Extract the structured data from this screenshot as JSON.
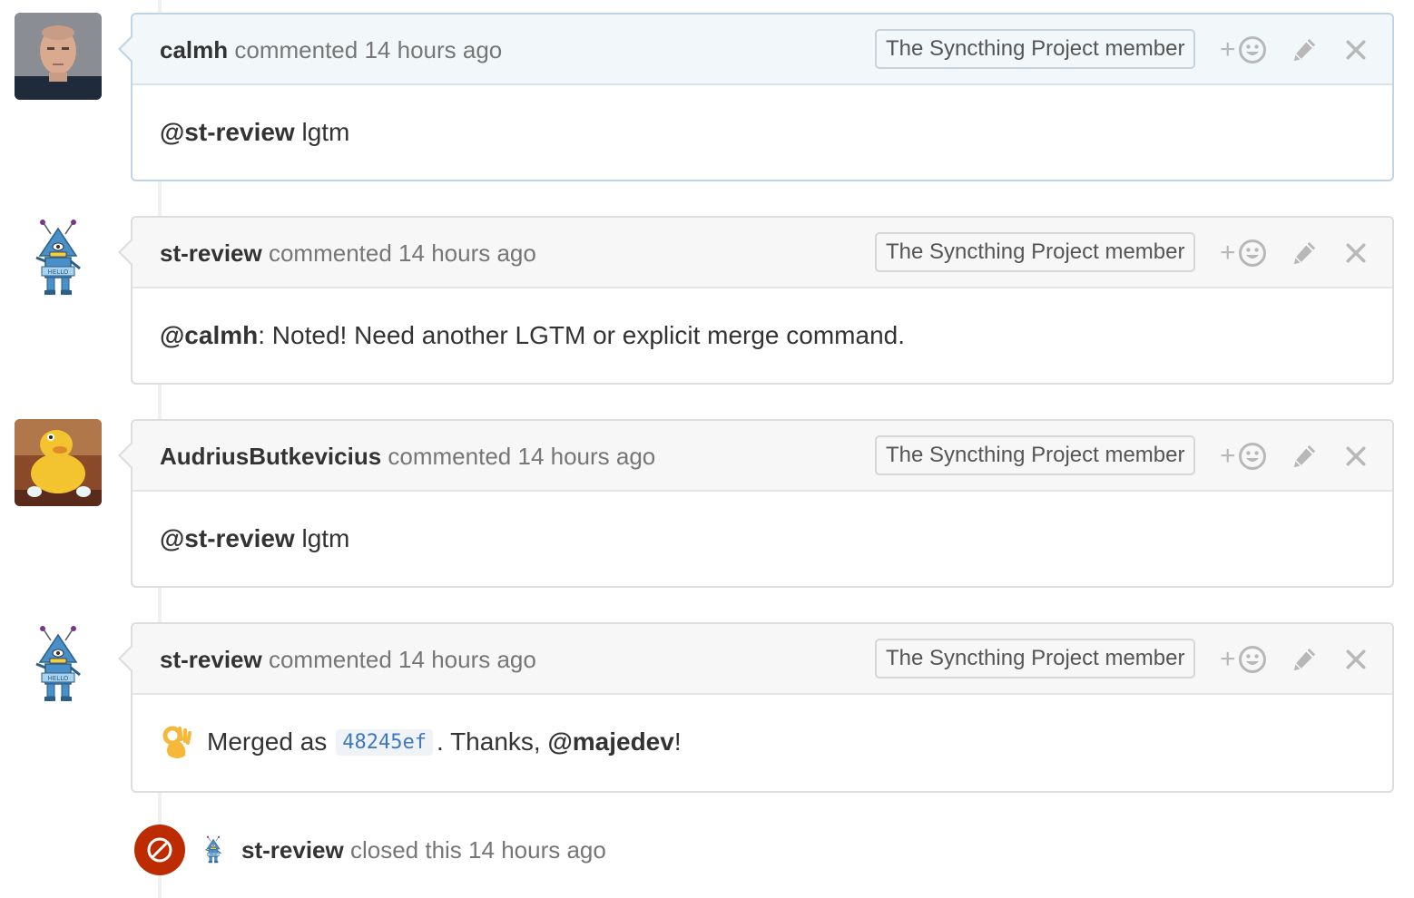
{
  "comments": [
    {
      "author": "calmh",
      "action": "commented",
      "time": "14 hours ago",
      "badge": "The Syncthing Project member",
      "avatar": "calmh-photo-avatar",
      "body": {
        "mention": "@st-review",
        "text": " lgtm"
      }
    },
    {
      "author": "st-review",
      "action": "commented",
      "time": "14 hours ago",
      "badge": "The Syncthing Project member",
      "avatar": "robot-avatar",
      "body": {
        "mention": "@calmh",
        "text": ": Noted! Need another LGTM or explicit merge command."
      }
    },
    {
      "author": "AudriusButkevicius",
      "action": "commented",
      "time": "14 hours ago",
      "badge": "The Syncthing Project member",
      "avatar": "yellow-puppet-avatar",
      "body": {
        "mention": "@st-review",
        "text": " lgtm"
      }
    },
    {
      "author": "st-review",
      "action": "commented",
      "time": "14 hours ago",
      "badge": "The Syncthing Project member",
      "avatar": "robot-avatar",
      "body": {
        "emoji": "ok-hand-emoji",
        "prefix": "Merged as",
        "sha": "48245ef",
        "middle": ". Thanks, ",
        "mention": "@majedev",
        "suffix": "!"
      }
    }
  ],
  "closed_event": {
    "author": "st-review",
    "text": "closed this",
    "time": "14 hours ago",
    "icon": "circle-slash-icon",
    "color": "#bd2c00"
  },
  "actions": {
    "react_plus": "+",
    "icons": [
      "smiley-icon",
      "pencil-icon",
      "close-icon"
    ]
  },
  "colors": {
    "header_bg": "#f7f7f7",
    "highlight_header_bg": "#f2f8fa",
    "link_blue": "#4078c0"
  }
}
